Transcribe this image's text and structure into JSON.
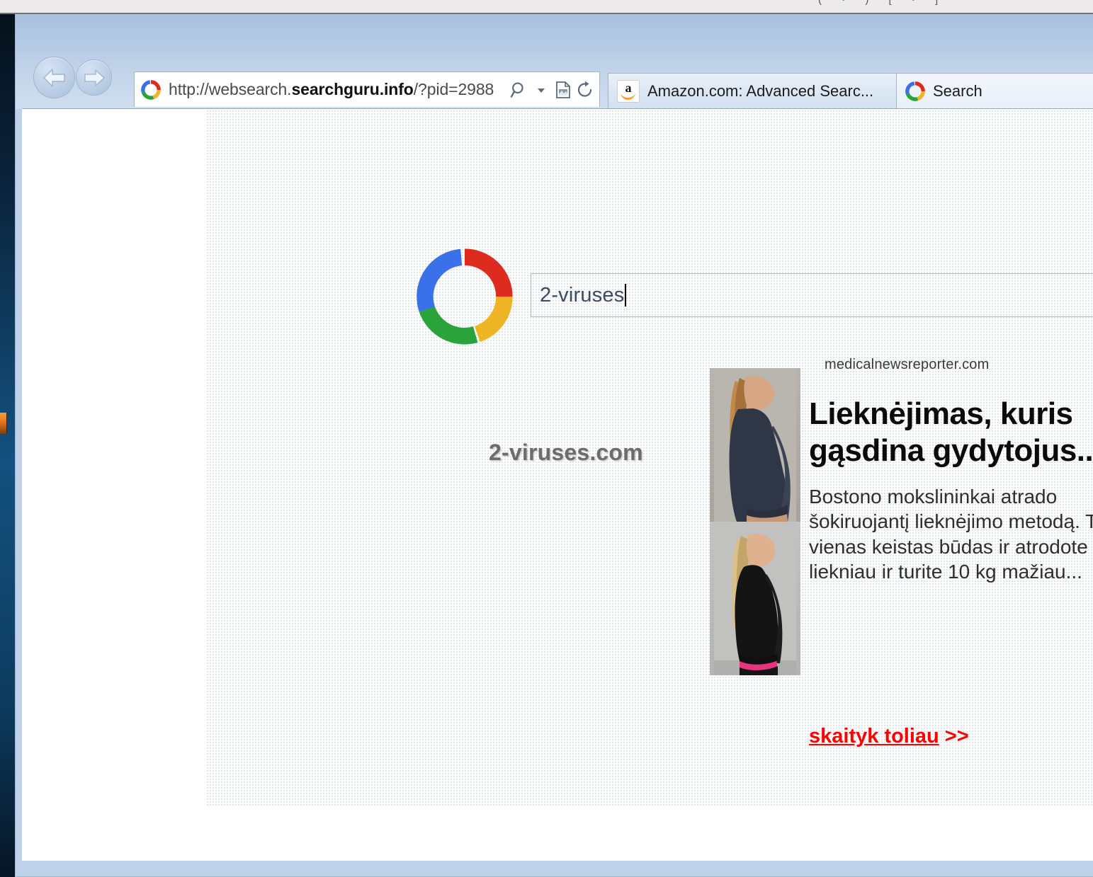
{
  "browser": {
    "nav": {
      "back_label": "Back",
      "forward_label": "Forward"
    },
    "address_bar": {
      "url_prefix": "http://websearch.",
      "url_domain": "searchguru.info",
      "url_suffix": "/?pid=2988",
      "favicon": "searchguru-ring-icon",
      "icons": [
        "search-icon",
        "chevron-down-icon",
        "compatibility-view-icon",
        "refresh-icon"
      ]
    },
    "tabs": [
      {
        "label": "Amazon.com: Advanced Searc...",
        "icon": "amazon-favicon",
        "active": true
      },
      {
        "label": "Search",
        "icon": "searchguru-ring-icon",
        "active": false
      }
    ]
  },
  "page": {
    "logo_name": "searchguru-ring-logo",
    "search": {
      "value": "2-viruses",
      "placeholder": ""
    },
    "watermark": "2-viruses.com",
    "ad": {
      "source": "medicalnewsreporter.com",
      "title": "Lieknėjimas, kuris gąsdina gydytojus...",
      "body": "Bostono mokslininkai atrado šokiruojantį lieknėjimo metodą. Tai vienas keistas būdas ir atrodote liekniau ir turite 10 kg mažiau...",
      "cta_text": "skaityk toliau",
      "cta_arrows": " >>",
      "image_alt": "before-after-weight-loss-photo"
    }
  },
  "colors": {
    "ring_red": "#dd2c1f",
    "ring_blue": "#3b71e8",
    "ring_green": "#2aa33a",
    "ring_yellow": "#edb423",
    "cta_red": "#ff0000",
    "chrome_blue": "#bed1e8",
    "desktop_blue": "#14517f"
  }
}
